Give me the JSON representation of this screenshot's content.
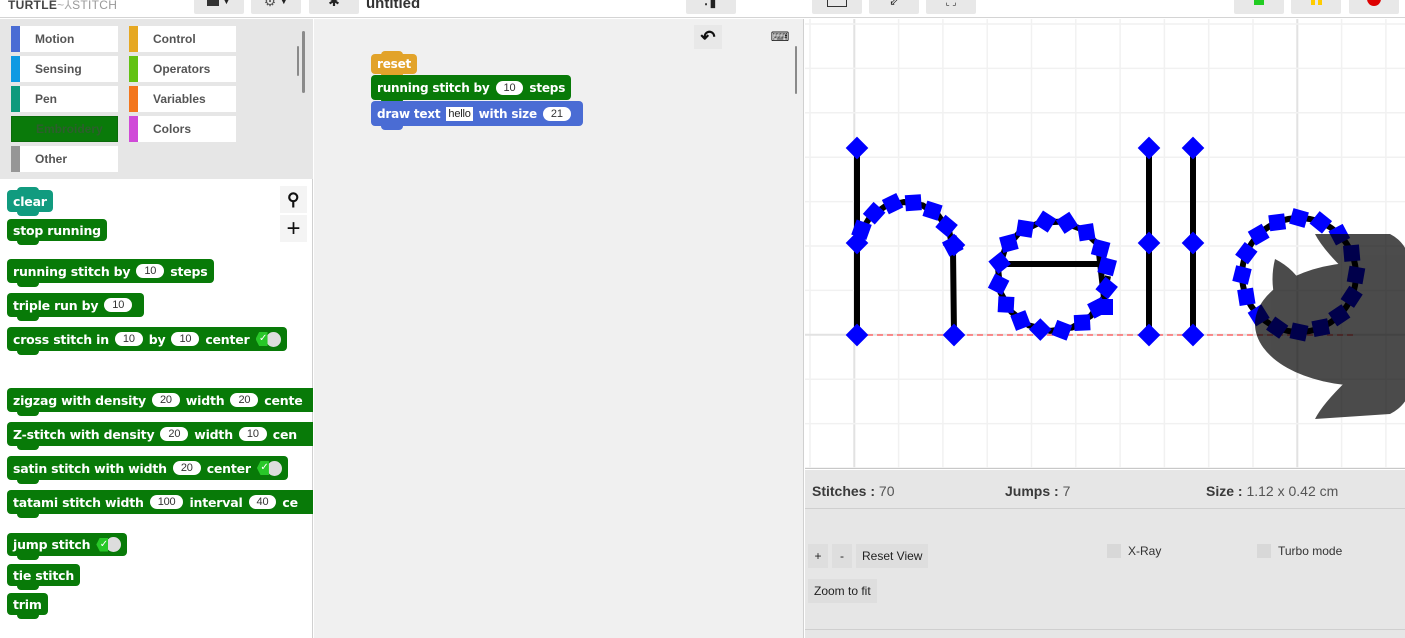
{
  "topbar": {
    "logo_left": "TURTLE",
    "logo_right": "STITCH",
    "project_title": "untitled",
    "buttons": {
      "file_menu": "file-menu",
      "settings_menu": "settings-menu",
      "costume": "turtle-costume",
      "footprints": "footprints",
      "normal_stage": "normal-stage",
      "small_stage": "small-stage",
      "fullscreen": "fullscreen"
    },
    "colors": {
      "flag": "#22cc22",
      "pause": "#ffcc00",
      "stop": "#dd0000"
    }
  },
  "categories": [
    {
      "label": "Motion",
      "color": "#4a6cd4"
    },
    {
      "label": "Control",
      "color": "#e6a822"
    },
    {
      "label": "Sensing",
      "color": "#0e9ae3"
    },
    {
      "label": "Operators",
      "color": "#62c213"
    },
    {
      "label": "Pen",
      "color": "#0e9a7c"
    },
    {
      "label": "Variables",
      "color": "#f3761d"
    },
    {
      "label": "Embroidery",
      "color": "#087a08",
      "active": true
    },
    {
      "label": "Colors",
      "color": "#d04ad8"
    },
    {
      "label": "Other",
      "color": "#969696"
    }
  ],
  "palette": {
    "blocks": [
      {
        "text": "clear"
      },
      {
        "text": "stop running"
      },
      {
        "parts": [
          "running stitch by",
          "10",
          "steps"
        ]
      },
      {
        "parts": [
          "triple run by",
          "10"
        ]
      },
      {
        "parts": [
          "cross stitch in",
          "10",
          "by",
          "10",
          "center"
        ],
        "toggle": true
      },
      {
        "parts": [
          "zigzag with density",
          "20",
          "width",
          "20",
          "cente"
        ]
      },
      {
        "parts": [
          "Z-stitch with density",
          "20",
          "width",
          "10",
          "cen"
        ]
      },
      {
        "parts": [
          "satin stitch with width",
          "20",
          "center"
        ],
        "toggle": true
      },
      {
        "parts": [
          "tatami stitch width",
          "100",
          "interval",
          "40",
          "ce"
        ]
      },
      {
        "text": "jump stitch",
        "toggle": true
      },
      {
        "text": "tie stitch"
      },
      {
        "text": "trim"
      }
    ]
  },
  "script": {
    "reset": "reset",
    "running": [
      "running stitch by",
      "10",
      "steps"
    ],
    "draw": [
      "draw text",
      "hello",
      "with size",
      "21"
    ]
  },
  "stats": {
    "stitches_label": "Stitches :",
    "stitches_value": "70",
    "jumps_label": "Jumps :",
    "jumps_value": "7",
    "size_label": "Size :",
    "size_value": "1.12 x 0.42 cm"
  },
  "controls": {
    "zoom_in": "+",
    "zoom_out": "-",
    "reset_view": "Reset View",
    "zoom_fit": "Zoom to fit",
    "xray": "X-Ray",
    "turbo": "Turbo mode"
  },
  "canvas": {
    "text": "hello",
    "stitch_color": "#0000ff",
    "thread_color": "#000000"
  }
}
